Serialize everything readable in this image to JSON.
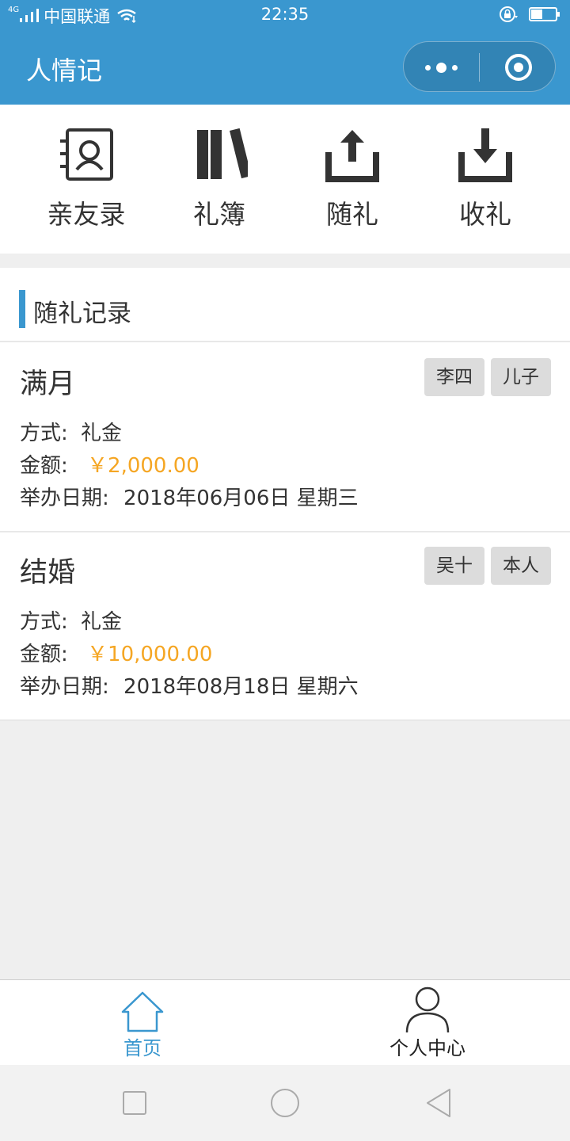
{
  "status_bar": {
    "network": "4G",
    "carrier": "中国联通",
    "time": "22:35",
    "battery_level": 0.45
  },
  "header": {
    "title": "人情记"
  },
  "quick_nav": [
    {
      "label": "亲友录",
      "icon": "contacts-book-icon"
    },
    {
      "label": "礼簿",
      "icon": "books-icon"
    },
    {
      "label": "随礼",
      "icon": "upload-icon"
    },
    {
      "label": "收礼",
      "icon": "download-icon"
    }
  ],
  "records_section": {
    "title": "随礼记录",
    "method_label": "方式:",
    "amount_label": "金额:",
    "date_label": "举办日期:",
    "items": [
      {
        "event": "满月",
        "tags": [
          "李四",
          "儿子"
        ],
        "method": "礼金",
        "amount": "￥2,000.00",
        "date": "2018年06月06日 星期三"
      },
      {
        "event": "结婚",
        "tags": [
          "吴十",
          "本人"
        ],
        "method": "礼金",
        "amount": "￥10,000.00",
        "date": "2018年08月18日 星期六"
      }
    ]
  },
  "tab_bar": {
    "tabs": [
      {
        "label": "首页",
        "icon": "home-icon",
        "active": true
      },
      {
        "label": "个人中心",
        "icon": "user-icon",
        "active": false
      }
    ]
  },
  "colors": {
    "primary": "#3a97cf",
    "amount": "#f5a623",
    "tag_bg": "#dcdcdc"
  }
}
